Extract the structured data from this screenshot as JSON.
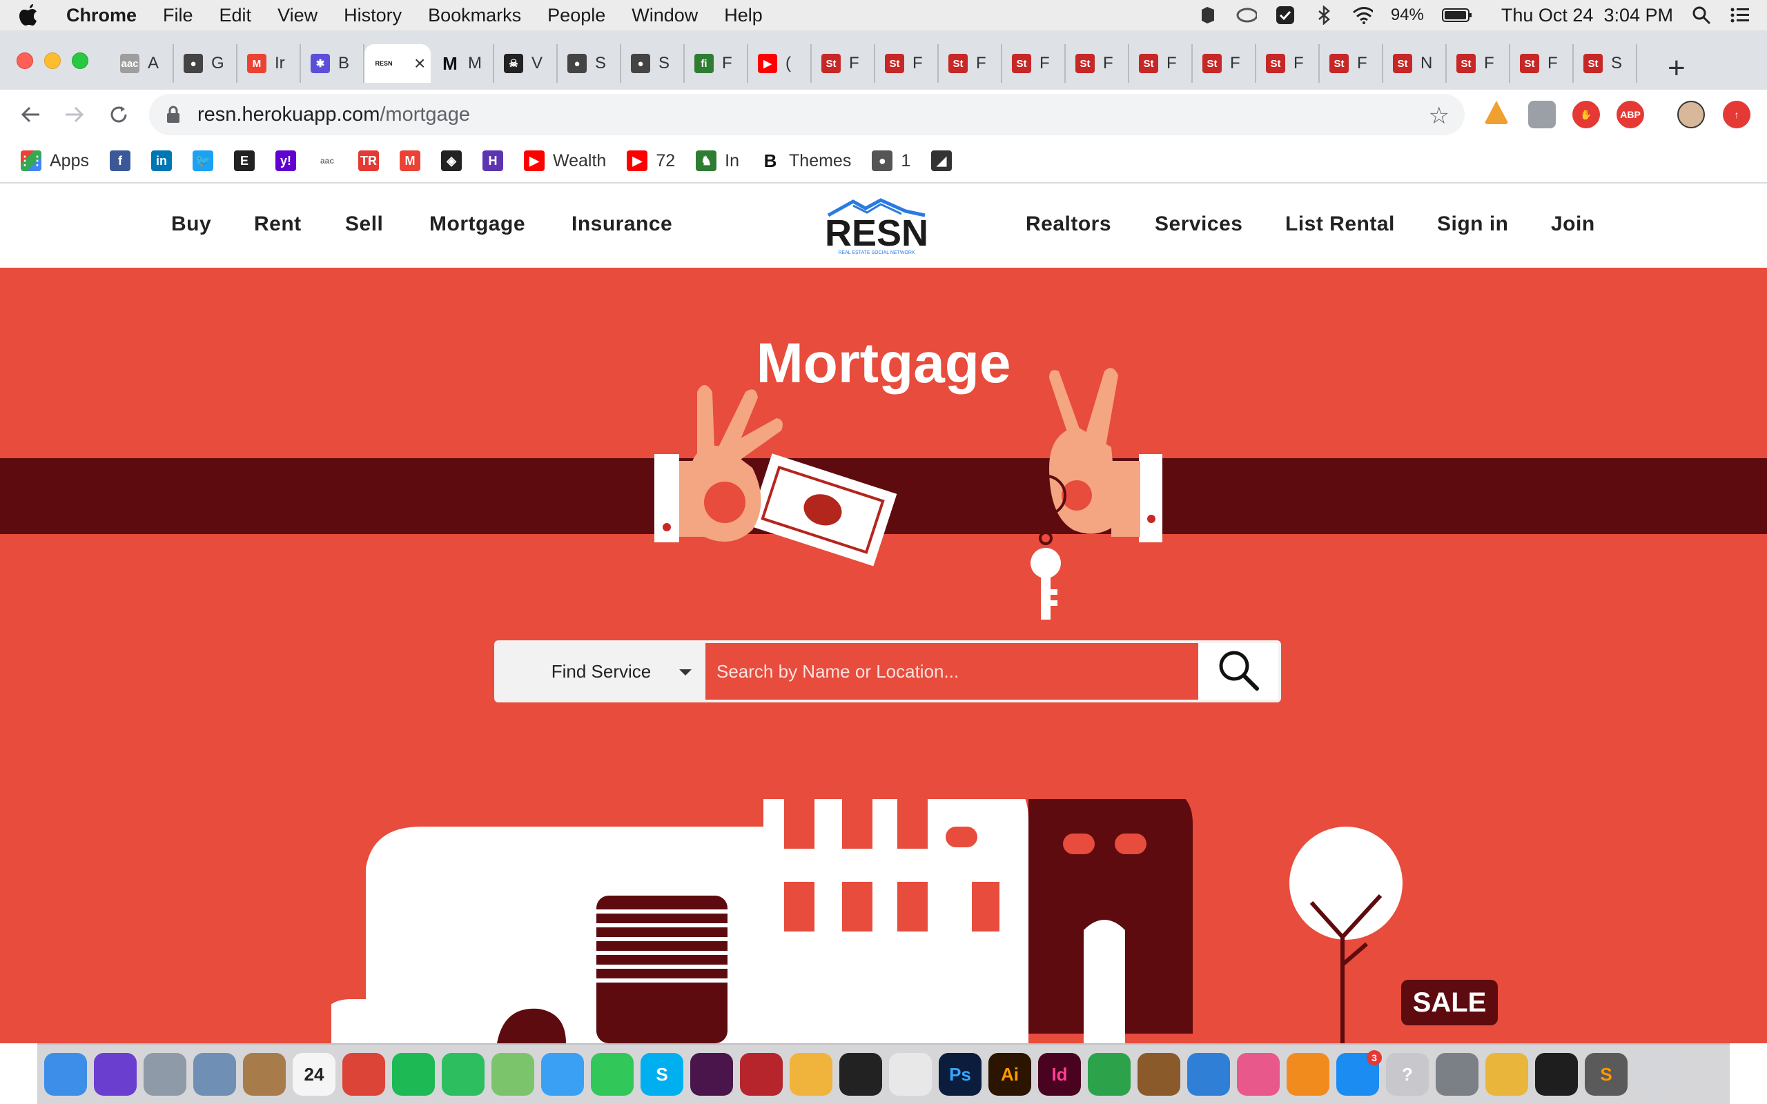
{
  "menubar": {
    "app_name": "Chrome",
    "items": [
      "File",
      "Edit",
      "View",
      "History",
      "Bookmarks",
      "People",
      "Window",
      "Help"
    ],
    "battery": "94%",
    "datetime": "Thu Oct 24  3:04 PM"
  },
  "tabs": [
    {
      "label": "A",
      "icon": "aac-icon"
    },
    {
      "label": "G",
      "icon": "globe-icon"
    },
    {
      "label": "Ir",
      "icon": "gmail-icon"
    },
    {
      "label": "B",
      "icon": "puzzle-icon"
    },
    {
      "label": "",
      "icon": "resn-icon",
      "active": true
    },
    {
      "label": "M",
      "icon": "medium-icon"
    },
    {
      "label": "V",
      "icon": "skull-icon"
    },
    {
      "label": "S",
      "icon": "globe-icon"
    },
    {
      "label": "S",
      "icon": "globe-icon"
    },
    {
      "label": "F",
      "icon": "fi-icon"
    },
    {
      "label": "(",
      "icon": "youtube-icon"
    },
    {
      "label": "F",
      "icon": "stock-icon"
    },
    {
      "label": "F",
      "icon": "stock-icon"
    },
    {
      "label": "F",
      "icon": "stock-icon"
    },
    {
      "label": "F",
      "icon": "stock-icon"
    },
    {
      "label": "F",
      "icon": "stock-icon"
    },
    {
      "label": "F",
      "icon": "stock-icon"
    },
    {
      "label": "F",
      "icon": "stock-icon"
    },
    {
      "label": "F",
      "icon": "stock-icon"
    },
    {
      "label": "F",
      "icon": "stock-icon"
    },
    {
      "label": "N",
      "icon": "stock-icon"
    },
    {
      "label": "F",
      "icon": "stock-icon"
    },
    {
      "label": "F",
      "icon": "stock-icon"
    },
    {
      "label": "S",
      "icon": "stock-icon"
    }
  ],
  "address": {
    "host": "resn.herokuapp.com",
    "path": "/mortgage"
  },
  "bookmarks": [
    {
      "label": "Apps",
      "icon": "apps-grid-icon",
      "color": "#4285f4"
    },
    {
      "label": "",
      "icon": "facebook-icon",
      "color": "#3b5998"
    },
    {
      "label": "",
      "icon": "linkedin-icon",
      "color": "#0077b5"
    },
    {
      "label": "",
      "icon": "twitter-icon",
      "color": "#1da1f2"
    },
    {
      "label": "",
      "icon": "etsy-icon",
      "color": "#222222"
    },
    {
      "label": "",
      "icon": "yahoo-icon",
      "color": "#6001d2"
    },
    {
      "label": "",
      "icon": "aac-icon",
      "color": "#9e9e9e"
    },
    {
      "label": "",
      "icon": "tr-icon",
      "color": "#e53935"
    },
    {
      "label": "",
      "icon": "gmail-icon",
      "color": "#ea4335"
    },
    {
      "label": "",
      "icon": "codepen-icon",
      "color": "#222222"
    },
    {
      "label": "",
      "icon": "h-icon",
      "color": "#5e35b1"
    },
    {
      "label": "Wealth",
      "icon": "youtube-icon",
      "color": "#ff0000"
    },
    {
      "label": "72",
      "icon": "youtube-icon",
      "color": "#ff0000"
    },
    {
      "label": "In",
      "icon": "eagle-icon",
      "color": "#2e7d32"
    },
    {
      "label": "Themes",
      "icon": "b-icon",
      "color": "#111111"
    },
    {
      "label": "1",
      "icon": "globe-icon",
      "color": "#555555"
    },
    {
      "label": "",
      "icon": "sb-icon",
      "color": "#333333"
    }
  ],
  "site": {
    "nav_left": [
      "Buy",
      "Rent",
      "Sell",
      "Mortgage",
      "Insurance"
    ],
    "nav_right": [
      "Realtors",
      "Services",
      "List Rental",
      "Sign in",
      "Join"
    ],
    "logo_text": "RESN",
    "logo_tagline": "REAL ESTATE SOCIAL NETWORK",
    "hero_title": "Mortgage",
    "search_select": "Find Service",
    "search_placeholder": "Search by Name or Location...",
    "sale_sign": "SALE"
  },
  "colors": {
    "hero_bg": "#e74c3c",
    "band": "#5e0b10",
    "brand_dark": "#1b1b1b",
    "brand_blue": "#2a7ae2"
  },
  "dock": [
    {
      "name": "finder-icon",
      "color": "#3d8ee8"
    },
    {
      "name": "siri-icon",
      "color": "#6a3fd0"
    },
    {
      "name": "launchpad-icon",
      "color": "#8e9aa8"
    },
    {
      "name": "preview-icon",
      "color": "#6f8fb5"
    },
    {
      "name": "notes-icon",
      "color": "#a87b4a"
    },
    {
      "name": "calendar-icon",
      "color": "#f5f5f5",
      "label": "24"
    },
    {
      "name": "chrome-icon",
      "color": "#db4437"
    },
    {
      "name": "spotify-icon",
      "color": "#1db954"
    },
    {
      "name": "evernote-icon",
      "color": "#2dbe60"
    },
    {
      "name": "maps-icon",
      "color": "#7cc46b"
    },
    {
      "name": "messages-icon",
      "color": "#3aa0f4"
    },
    {
      "name": "facetime-icon",
      "color": "#32c759"
    },
    {
      "name": "skype-icon",
      "color": "#00aff0",
      "label": "S"
    },
    {
      "name": "slack-icon",
      "color": "#4a154b"
    },
    {
      "name": "photobooth-icon",
      "color": "#b5252b"
    },
    {
      "name": "photos-icon",
      "color": "#f0b43c"
    },
    {
      "name": "terminal-exec-icon",
      "color": "#222222"
    },
    {
      "name": "textedit-icon",
      "color": "#e8e8e8"
    },
    {
      "name": "photoshop-icon",
      "color": "#0b1c3d",
      "label": "Ps"
    },
    {
      "name": "illustrator-icon",
      "color": "#2b1400",
      "label": "Ai"
    },
    {
      "name": "indesign-icon",
      "color": "#49021f",
      "label": "Id"
    },
    {
      "name": "numbers-icon",
      "color": "#2ca34a"
    },
    {
      "name": "garageband-icon",
      "color": "#8a5a2b"
    },
    {
      "name": "keynote-icon",
      "color": "#2f7fd7"
    },
    {
      "name": "itunes-icon",
      "color": "#e9588a"
    },
    {
      "name": "books-icon",
      "color": "#f28b1e"
    },
    {
      "name": "appstore-icon",
      "color": "#1b8cf2",
      "badge": "3"
    },
    {
      "name": "help-icon",
      "color": "#c8c8cc",
      "label": "?"
    },
    {
      "name": "system-preferences-icon",
      "color": "#7b7f86"
    },
    {
      "name": "transmit-icon",
      "color": "#e9b53a"
    },
    {
      "name": "terminal-icon",
      "color": "#1e1e1e"
    },
    {
      "name": "sublime-icon",
      "color": "#5a5a5a",
      "label": "S"
    },
    {
      "name": "trash-icon",
      "color": "#d5d6d9"
    }
  ]
}
